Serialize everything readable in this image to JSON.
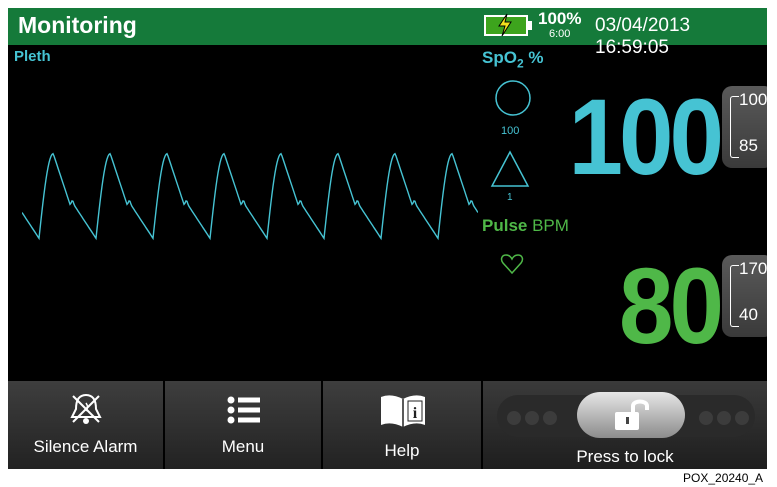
{
  "header": {
    "title": "Monitoring",
    "battery_percent": "100%",
    "battery_time": "6:00",
    "datetime": "03/04/2013 16:59:05"
  },
  "pleth": {
    "label": "Pleth"
  },
  "spo2": {
    "label_main": "SpO",
    "label_sub": "2",
    "label_unit": " %",
    "value": "100",
    "signal_value": "100",
    "sensitivity_value": "1",
    "limit_high": "100",
    "limit_low": "85"
  },
  "pulse": {
    "label_bold": "Pulse",
    "label_unit": " BPM",
    "value": "80",
    "limit_high": "170",
    "limit_low": "40"
  },
  "buttons": {
    "silence": "Silence Alarm",
    "menu": "Menu",
    "help": "Help",
    "lock": "Press to lock"
  },
  "caption": "POX_20240_A",
  "colors": {
    "header_bg": "#157a3a",
    "spo2": "#46c3d3",
    "pulse": "#4fb848"
  },
  "icons": [
    "battery-charging-icon",
    "signal-circle-icon",
    "sensitivity-triangle-icon",
    "heart-icon",
    "bell-icon",
    "menu-list-icon",
    "help-book-icon",
    "unlock-icon"
  ]
}
